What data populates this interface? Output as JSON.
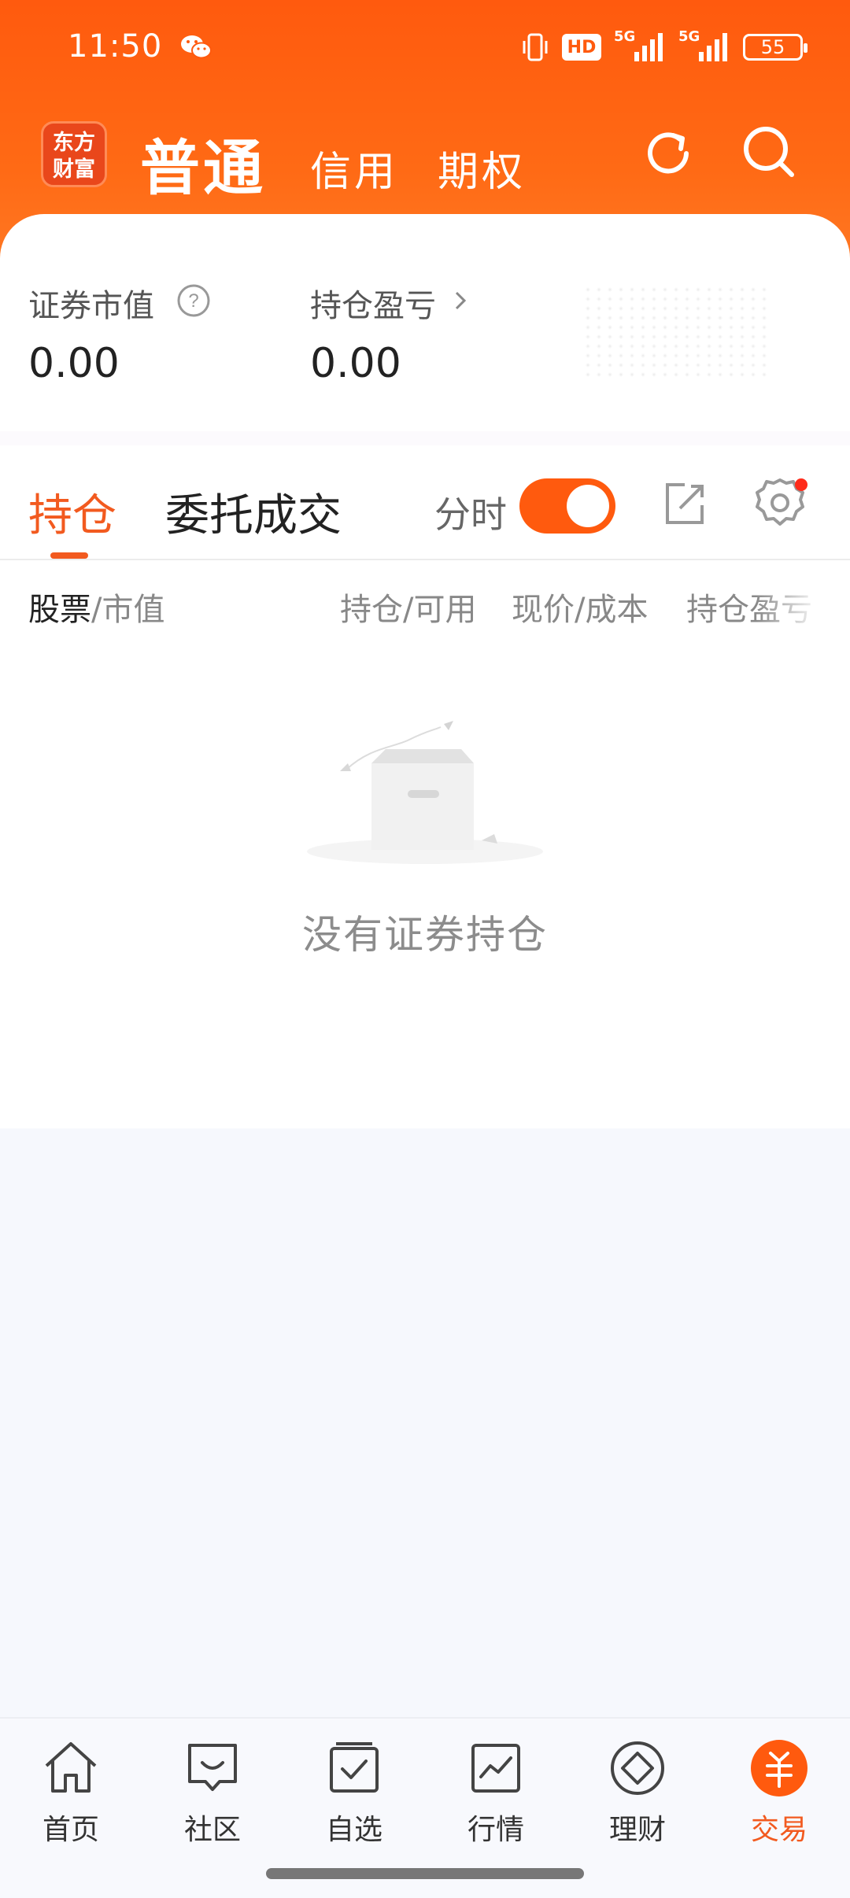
{
  "status_bar": {
    "time": "11:50",
    "hd_label": "HD",
    "network1": "5G",
    "network2": "5G",
    "battery": "55"
  },
  "header": {
    "logo_line1": "东方",
    "logo_line2": "财富",
    "tabs": [
      {
        "label": "普通",
        "active": true
      },
      {
        "label": "信用",
        "active": false
      },
      {
        "label": "期权",
        "active": false
      }
    ],
    "icons": [
      "refresh-icon",
      "search-icon"
    ]
  },
  "summary": {
    "market_value_label": "证券市值",
    "market_value": "0.00",
    "pnl_label": "持仓盈亏",
    "pnl_value": "0.00"
  },
  "positions_tabs": {
    "holdings": "持仓",
    "orders": "委托成交",
    "fenshi_label": "分时",
    "fenshi_on": true
  },
  "table_header": {
    "stock": "股票",
    "market_value": "/市值",
    "position_available": "持仓/可用",
    "price_cost": "现价/成本",
    "pnl": "持仓盈亏"
  },
  "empty_state": {
    "message": "没有证券持仓"
  },
  "bottom_nav": [
    {
      "label": "首页",
      "icon": "home-icon",
      "active": false
    },
    {
      "label": "社区",
      "icon": "community-icon",
      "active": false
    },
    {
      "label": "自选",
      "icon": "watchlist-icon",
      "active": false
    },
    {
      "label": "行情",
      "icon": "market-icon",
      "active": false
    },
    {
      "label": "理财",
      "icon": "wealth-icon",
      "active": false
    },
    {
      "label": "交易",
      "icon": "trade-icon",
      "active": true
    }
  ],
  "colors": {
    "accent": "#ff5a0e",
    "active_text": "#f25a1f",
    "background": "#f6f8fd"
  }
}
